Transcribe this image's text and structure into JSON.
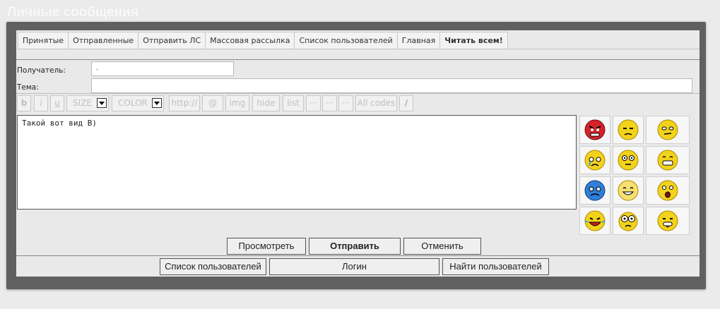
{
  "page": {
    "title": "Личные сообщения"
  },
  "tabs": [
    {
      "label": "Принятые",
      "bold": false
    },
    {
      "label": "Отправленные",
      "bold": false
    },
    {
      "label": "Отправить ЛС",
      "bold": false
    },
    {
      "label": "Массовая рассылка",
      "bold": false
    },
    {
      "label": "Список пользователей",
      "bold": false
    },
    {
      "label": "Главная",
      "bold": false
    },
    {
      "label": "Читать всем!",
      "bold": true
    }
  ],
  "form": {
    "recipient_label": "Получатель:",
    "recipient_value": ".",
    "subject_label": "Тема:",
    "subject_value": "",
    "message": "Такой вот вид  В)"
  },
  "toolbar": {
    "bold": "b",
    "italic": "i",
    "underline": "u",
    "size": "SIZE",
    "color": "COLOR",
    "url": "http://",
    "email": "@",
    "img": "img",
    "hide": "hide",
    "list": "list",
    "extra1": "···",
    "extra2": "···",
    "extra3": "···",
    "all_codes": "All codes",
    "close": "/"
  },
  "smiles": [
    "angry-smile-icon",
    "sad-smile-icon",
    "suspicious-smile-icon",
    "crying-smile-icon",
    "surprised-smile-icon",
    "grinning-smile-icon",
    "blue-cold-smile-icon",
    "happy-smile-icon",
    "shocked-smile-icon",
    "laughing-smile-icon",
    "big-eyes-smile-icon",
    "tongue-smile-icon"
  ],
  "buttons": {
    "preview": "Просмотреть",
    "send": "Отправить",
    "cancel": "Отменить",
    "user_list": "Список пользователей",
    "login": "Логин",
    "find_users": "Найти пользователей"
  },
  "colors": {
    "panel": "#606060",
    "background": "#ebebeb",
    "smile_yellow": "#f2d21b",
    "smile_red": "#d3232a",
    "smile_blue": "#2f7fd8"
  }
}
